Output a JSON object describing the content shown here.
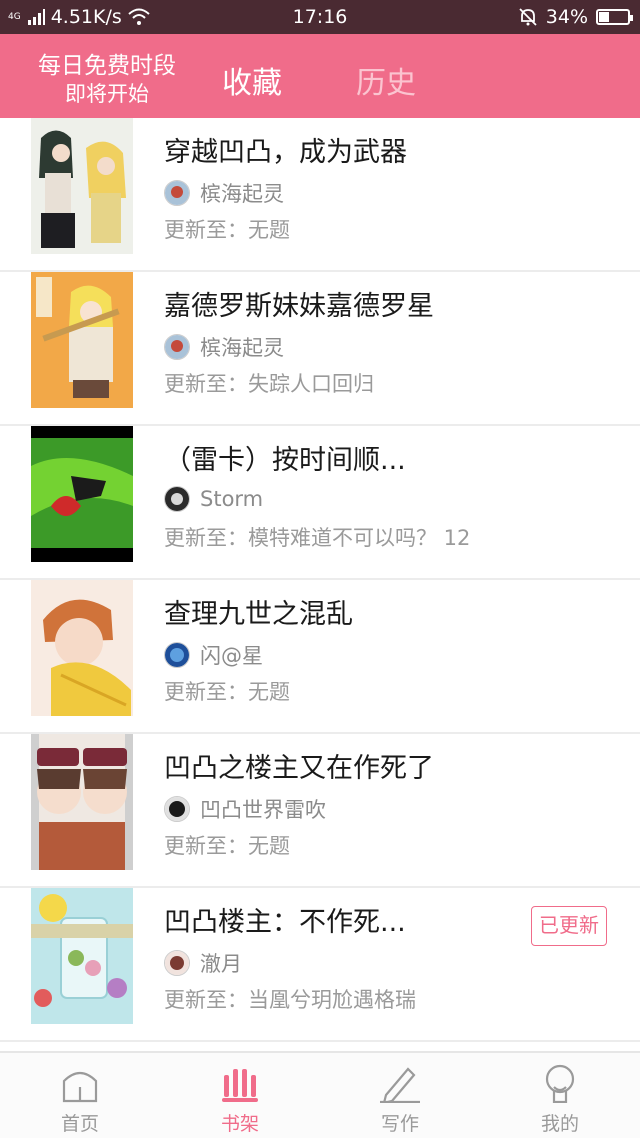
{
  "status_bar": {
    "network": "4G",
    "speed": "4.51K/s",
    "time": "17:16",
    "battery": "34%",
    "battery_level": 0.34
  },
  "header": {
    "free_line1": "每日免费时段",
    "free_line2": "即将开始",
    "tab_favorites": "收藏",
    "tab_history": "历史",
    "bg_color": "#f06c8a"
  },
  "items": [
    {
      "title": "穿越凹凸，成为武器",
      "author": "槟海起灵",
      "update": "更新至：无题",
      "badge": ""
    },
    {
      "title": "嘉德罗斯妹妹嘉德罗星",
      "author": "槟海起灵",
      "update": "更新至：失踪人口回归",
      "badge": ""
    },
    {
      "title": "（雷卡）按时间顺...",
      "author": "Storm",
      "update": "更新至：模特难道不可以吗？ 12",
      "badge": ""
    },
    {
      "title": "查理九世之混乱",
      "author": "闪@星",
      "update": "更新至：无题",
      "badge": ""
    },
    {
      "title": "凹凸之楼主又在作死了",
      "author": "凹凸世界雷吹",
      "update": "更新至：无题",
      "badge": ""
    },
    {
      "title": "凹凸楼主：不作死...",
      "author": "澈月",
      "update": "更新至：当凰兮玥尬遇格瑞",
      "badge": "已更新"
    }
  ],
  "bottom_nav": {
    "home": "首页",
    "bookshelf": "书架",
    "write": "写作",
    "me": "我的",
    "active": "bookshelf",
    "accent": "#f06c8a"
  }
}
